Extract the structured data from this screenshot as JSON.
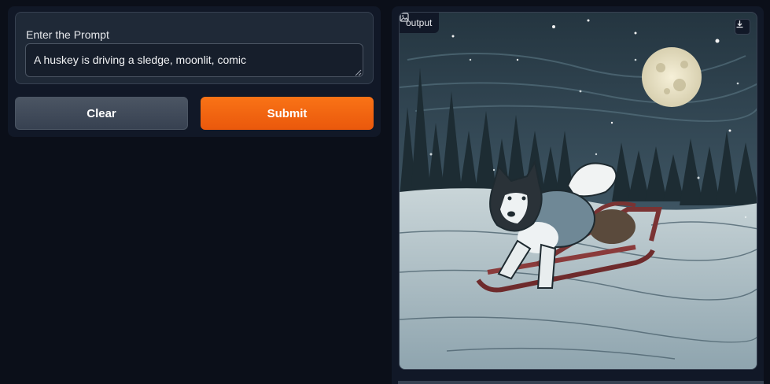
{
  "prompt": {
    "label": "Enter the Prompt",
    "value": "A huskey is driving a sledge, moonlit, comic"
  },
  "buttons": {
    "clear_label": "Clear",
    "submit_label": "Submit"
  },
  "output": {
    "label": "output",
    "icon": "image-icon",
    "download_icon": "download-icon"
  },
  "colors": {
    "background": "#0b0f19",
    "panel": "#111827",
    "accent": "#f97316",
    "secondary_button": "#4b5563"
  }
}
